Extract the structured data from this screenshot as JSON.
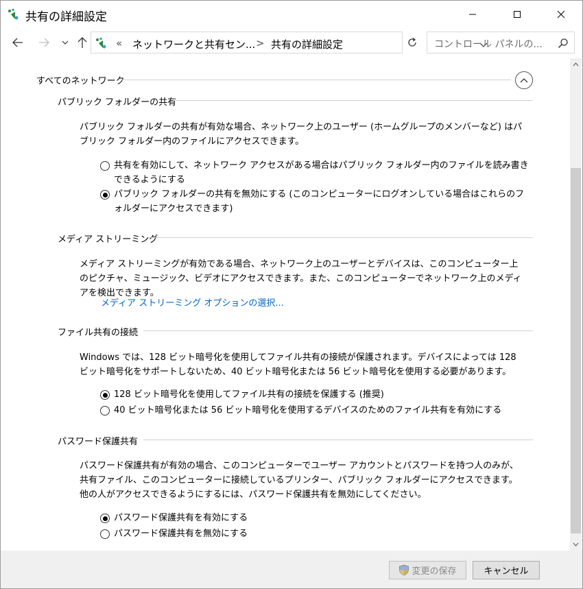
{
  "window": {
    "title": "共有の詳細設定"
  },
  "address_bar": {
    "overflow": "«",
    "crumb1": "ネットワークと共有セン...",
    "separator": ">",
    "crumb2": "共有の詳細設定"
  },
  "search": {
    "placeholder": "コントロール パネルの..."
  },
  "content": {
    "all_networks": "すべてのネットワーク",
    "sections": [
      {
        "heading": "パブリック フォルダーの共有",
        "description": "パブリック フォルダーの共有が有効な場合、ネットワーク上のユーザー (ホームグループのメンバーなど) はパブリック フォルダー内のファイルにアクセスできます。",
        "options": [
          {
            "label": "共有を有効にして、ネットワーク アクセスがある場合はパブリック フォルダー内のファイルを読み書きできるようにする",
            "checked": false
          },
          {
            "label": "パブリック フォルダーの共有を無効にする (このコンピューターにログオンしている場合はこれらのフォルダーにアクセスできます)",
            "checked": true
          }
        ]
      },
      {
        "heading": "メディア ストリーミング",
        "description": "メディア ストリーミングが有効である場合、ネットワーク上のユーザーとデバイスは、このコンピューター上のピクチャ、ミュージック、ビデオにアクセスできます。また、このコンピューターでネットワーク上のメディアを検出できます。",
        "link": "メディア ストリーミング オプションの選択..."
      },
      {
        "heading": "ファイル共有の接続",
        "description": "Windows では、128 ビット暗号化を使用してファイル共有の接続が保護されます。デバイスによっては 128 ビット暗号化をサポートしないため、40 ビット暗号化または 56 ビット暗号化を使用する必要があります。",
        "options": [
          {
            "label": "128 ビット暗号化を使用してファイル共有の接続を保護する (推奨)",
            "checked": true
          },
          {
            "label": "40 ビット暗号化または 56 ビット暗号化を使用するデバイスのためのファイル共有を有効にする",
            "checked": false
          }
        ]
      },
      {
        "heading": "パスワード保護共有",
        "description": "パスワード保護共有が有効の場合、このコンピューターでユーザー アカウントとパスワードを持つ人のみが、共有ファイル、このコンピューターに接続しているプリンター、パブリック フォルダーにアクセスできます。他の人がアクセスできるようにするには、パスワード保護共有を無効にしてください。",
        "options": [
          {
            "label": "パスワード保護共有を有効にする",
            "checked": true
          },
          {
            "label": "パスワード保護共有を無効にする",
            "checked": false
          }
        ]
      }
    ]
  },
  "footer": {
    "save_label": "変更の保存",
    "cancel_label": "キャンセル"
  },
  "colors": {
    "link": "#0066cc",
    "footer_bg": "#f0f0f0"
  },
  "icons": {
    "app": "network-icon",
    "back": "arrow-left-icon",
    "forward": "arrow-right-icon",
    "recent": "chevron-down-icon",
    "up": "arrow-up-icon",
    "refresh": "refresh-icon",
    "search": "search-icon",
    "shield": "uac-shield-icon"
  }
}
